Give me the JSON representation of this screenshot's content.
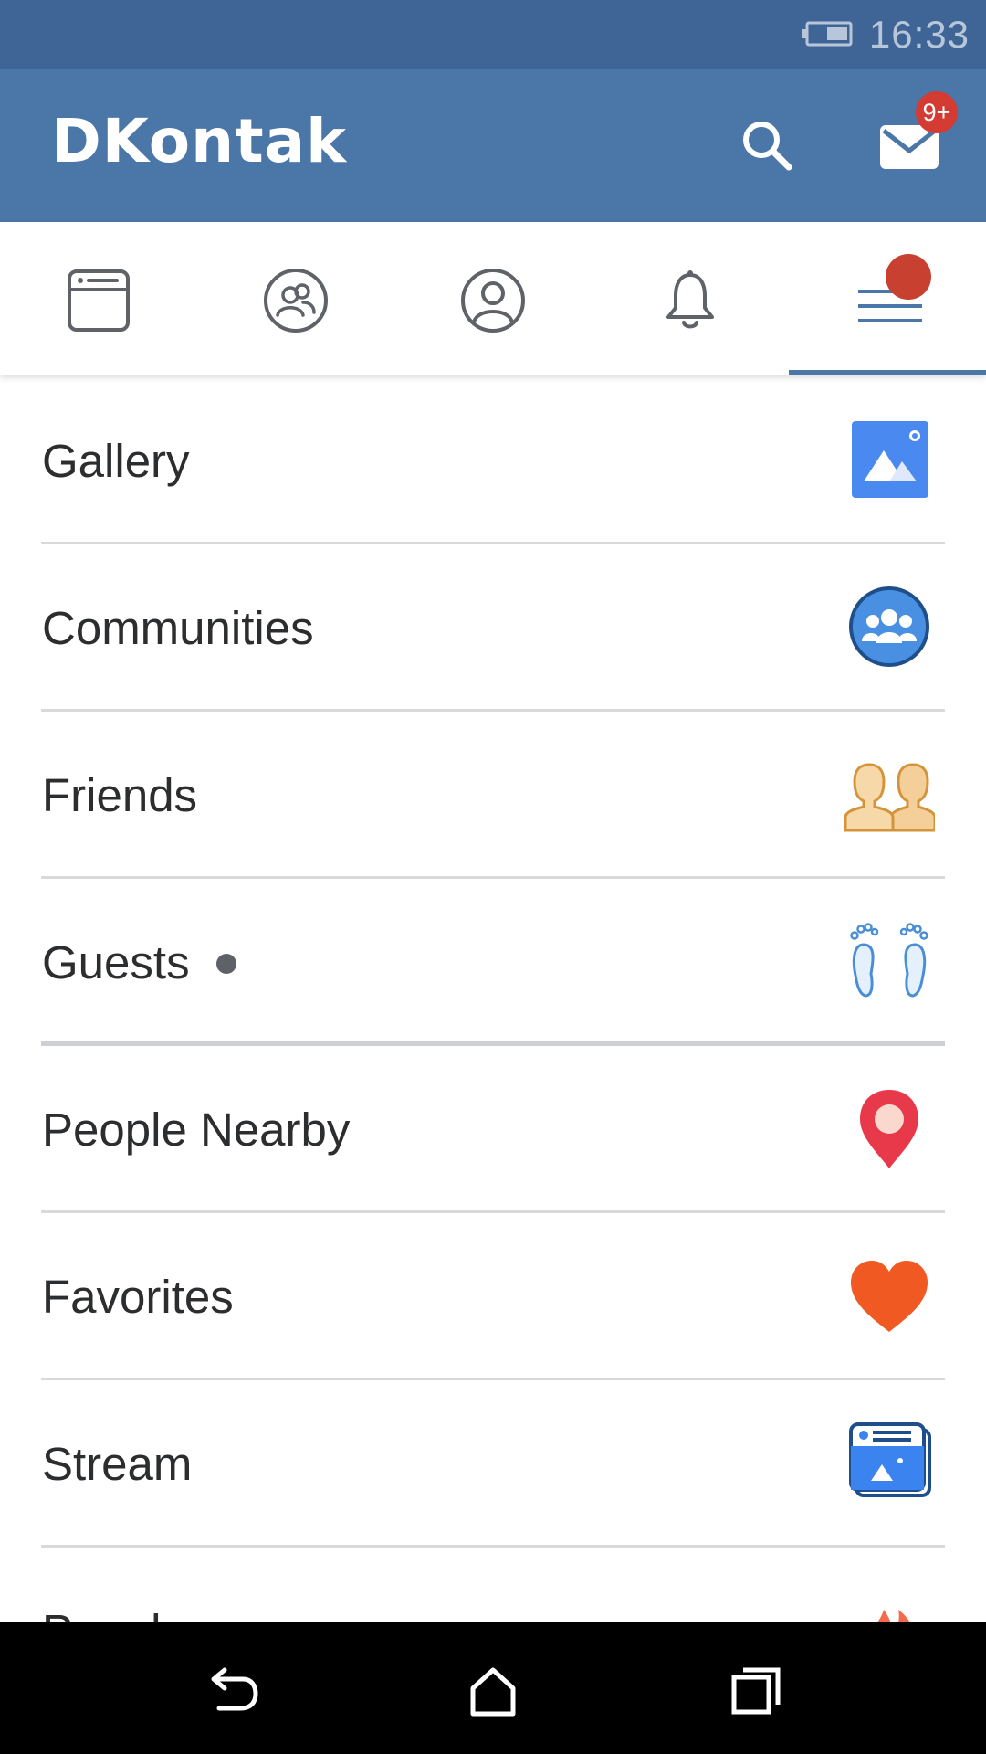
{
  "status_bar": {
    "time": "16:33",
    "battery_icon": "battery-icon"
  },
  "app_bar": {
    "title": "DKontak",
    "search_icon": "search-icon",
    "mail_icon": "mail-icon",
    "mail_badge": "9+"
  },
  "tabs": [
    {
      "name": "news",
      "icon": "newsfeed-icon"
    },
    {
      "name": "friends",
      "icon": "friends-circle-icon"
    },
    {
      "name": "profile",
      "icon": "profile-icon"
    },
    {
      "name": "notifications",
      "icon": "bell-icon"
    },
    {
      "name": "menu",
      "icon": "menu-icon",
      "active": true
    }
  ],
  "menu": {
    "items": [
      {
        "label": "Gallery",
        "icon": "gallery-icon"
      },
      {
        "label": "Communities",
        "icon": "communities-icon"
      },
      {
        "label": "Friends",
        "icon": "friends-icon"
      },
      {
        "label": "Guests",
        "icon": "footprints-icon"
      },
      {
        "label": "People Nearby",
        "icon": "location-pin-icon"
      },
      {
        "label": "Favorites",
        "icon": "heart-icon"
      },
      {
        "label": "Stream",
        "icon": "stream-icon"
      },
      {
        "label": "Popular",
        "icon": "fire-icon"
      }
    ]
  },
  "colors": {
    "status_bar": "#3f6496",
    "app_bar": "#4a76a8",
    "badge": "#d43c33",
    "tab_indicator": "#4a76a8"
  },
  "nav_bar": {
    "back": "back-icon",
    "home": "home-icon",
    "recents": "recents-icon"
  }
}
